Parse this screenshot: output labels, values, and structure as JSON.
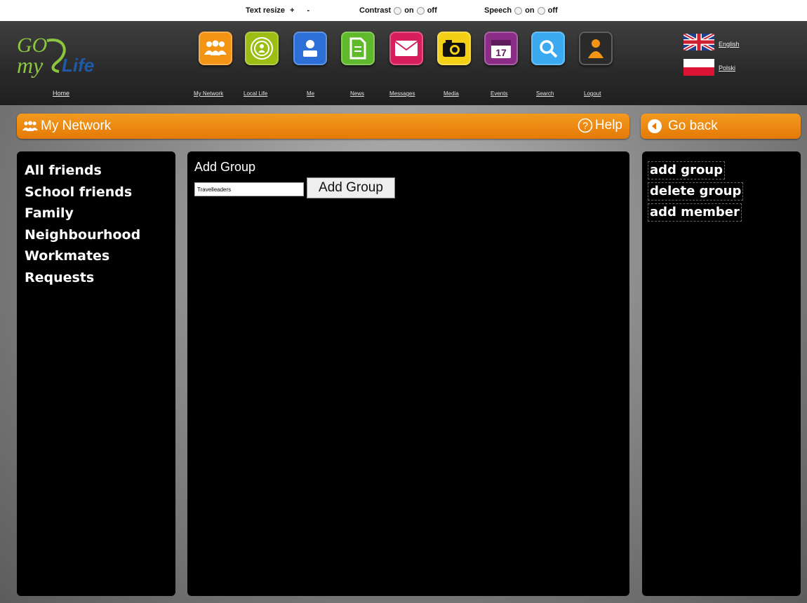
{
  "accessibility_bar": {
    "text_resize_label": "Text resize",
    "increase_label": "+",
    "decrease_label": "-",
    "contrast_label": "Contrast",
    "contrast_on": "on",
    "contrast_off": "off",
    "speech_label": "Speech",
    "speech_on": "on",
    "speech_off": "off"
  },
  "header": {
    "logo_text_1": "GO",
    "logo_text_2": "my",
    "logo_text_3": "Life",
    "home_label": "Home",
    "nav": [
      {
        "label": "My Network",
        "icon": "people-icon",
        "color": "#f39414"
      },
      {
        "label": "Local Life",
        "icon": "target-icon",
        "color": "#9cbd12"
      },
      {
        "label": "Me",
        "icon": "person-icon",
        "color": "#2c6fd6"
      },
      {
        "label": "News",
        "icon": "document-icon",
        "color": "#5fb92b"
      },
      {
        "label": "Messages",
        "icon": "envelope-icon",
        "color": "#d81f5d"
      },
      {
        "label": "Media",
        "icon": "camera-icon",
        "color": "#f3d015"
      },
      {
        "label": "Events",
        "icon": "calendar-icon",
        "color": "#8b2d86"
      },
      {
        "label": "Search",
        "icon": "magnifier-icon",
        "color": "#3aa9ef"
      },
      {
        "label": "Logout",
        "icon": "logout-icon",
        "color": "#2a2a2a"
      }
    ],
    "languages": [
      {
        "label": "English",
        "icon": "uk-flag-icon"
      },
      {
        "label": "Polski",
        "icon": "poland-flag-icon"
      }
    ]
  },
  "title_bar": {
    "title": "My Network",
    "help_label": "Help"
  },
  "go_back_label": "Go back",
  "left_panel": {
    "items": [
      "All friends",
      "School friends",
      "Family",
      "Neighbourhood",
      "Workmates",
      "Requests"
    ]
  },
  "main": {
    "heading": "Add Group",
    "group_name_value": "Travelleaders",
    "add_button_label": "Add Group"
  },
  "right_panel": {
    "actions": [
      "add group",
      "delete group",
      "add member"
    ]
  },
  "colors": {
    "accent_orange": "#e98a0f",
    "panel_background": "#000000",
    "header_background": "#2f2f2f"
  }
}
